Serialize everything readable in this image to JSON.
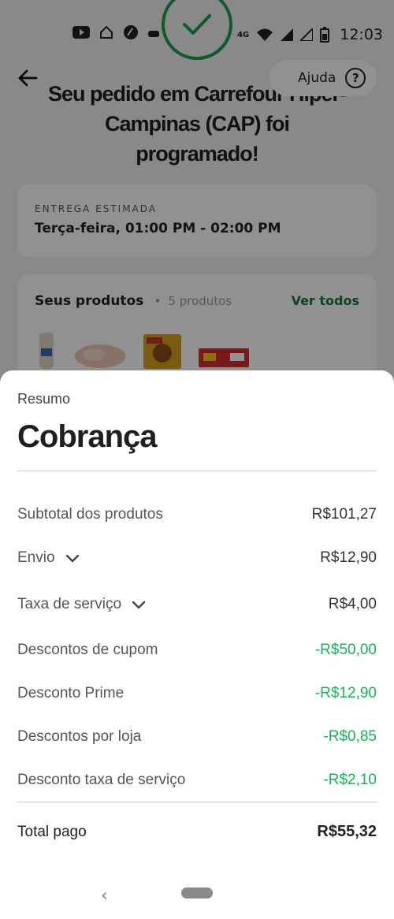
{
  "status_bar": {
    "time": "12:03",
    "network": "4G"
  },
  "header": {
    "help_label": "Ajuda",
    "help_icon_glyph": "?",
    "order_title": "Seu pedido em Carrefour Hiper- Campinas (CAP) foi programado!"
  },
  "delivery": {
    "label": "ENTREGA ESTIMADA",
    "value": "Terça-feira, 01:00 PM - 02:00 PM"
  },
  "products": {
    "title": "Seus produtos",
    "separator": "•",
    "count": "5 produtos",
    "see_all": "Ver todos"
  },
  "summary": {
    "subtitle": "Resumo",
    "title": "Cobrança",
    "rows": [
      {
        "label": "Subtotal dos produtos",
        "value": "R$101,27"
      },
      {
        "label": "Envio",
        "value": "R$12,90"
      },
      {
        "label": "Taxa de serviço",
        "value": "R$4,00"
      },
      {
        "label": "Descontos de cupom",
        "value": "-R$50,00"
      },
      {
        "label": "Desconto Prime",
        "value": "-R$12,90"
      },
      {
        "label": "Descontos por loja",
        "value": "-R$0,85"
      },
      {
        "label": "Desconto taxa de serviço",
        "value": "-R$2,10"
      }
    ],
    "total_label": "Total pago",
    "total_value": "R$55,32"
  },
  "nav": {
    "back_glyph": "‹"
  },
  "colors": {
    "accent_green": "#16b35a",
    "link_green": "#0e7a3e",
    "check_green": "#16a34a"
  }
}
